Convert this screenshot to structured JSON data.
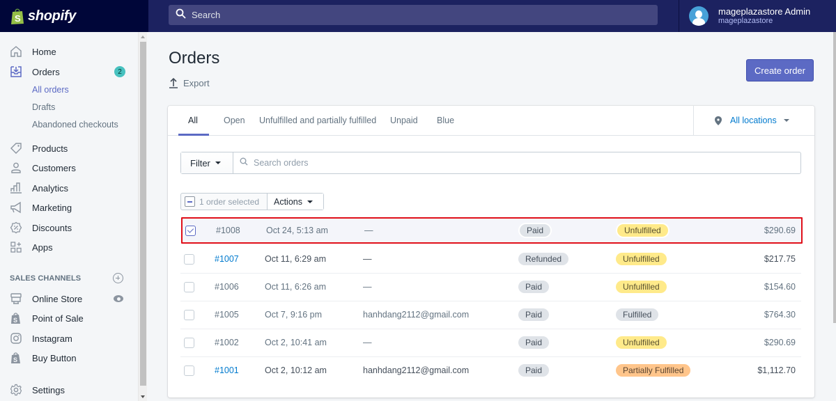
{
  "app": {
    "brand": "shopify",
    "search_placeholder": "Search",
    "user": {
      "name": "mageplazastore Admin",
      "store": "mageplazastore"
    }
  },
  "sidebar": {
    "items": [
      {
        "label": "Home",
        "icon": "home-icon"
      },
      {
        "label": "Orders",
        "icon": "orders-icon",
        "badge": "2"
      },
      {
        "label": "Products",
        "icon": "tag-icon"
      },
      {
        "label": "Customers",
        "icon": "person-icon"
      },
      {
        "label": "Analytics",
        "icon": "bar-chart-icon"
      },
      {
        "label": "Marketing",
        "icon": "megaphone-icon"
      },
      {
        "label": "Discounts",
        "icon": "discount-icon"
      },
      {
        "label": "Apps",
        "icon": "apps-icon"
      }
    ],
    "orders_sub": [
      "All orders",
      "Drafts",
      "Abandoned checkouts"
    ],
    "sales_channels_heading": "SALES CHANNELS",
    "channels": [
      {
        "label": "Online Store",
        "icon": "store-icon"
      },
      {
        "label": "Point of Sale",
        "icon": "shopping-bag-icon"
      },
      {
        "label": "Instagram",
        "icon": "instagram-icon"
      },
      {
        "label": "Buy Button",
        "icon": "shopping-bag-icon"
      }
    ],
    "settings": "Settings"
  },
  "page": {
    "title": "Orders",
    "export": "Export",
    "create_order": "Create order"
  },
  "tabs": [
    "All",
    "Open",
    "Unfulfilled and partially fulfilled",
    "Unpaid",
    "Blue"
  ],
  "active_tab": "All",
  "location": "All locations",
  "filter": {
    "label": "Filter",
    "search_placeholder": "Search orders"
  },
  "bulk": {
    "selected_text": "1 order selected",
    "actions": "Actions"
  },
  "orders": [
    {
      "number": "#1008",
      "date": "Oct 24, 5:13 am",
      "customer": "—",
      "payment": "Paid",
      "fulfillment": "Unfulfilled",
      "total": "$290.69",
      "selected": true
    },
    {
      "number": "#1007",
      "date": "Oct 11, 6:29 am",
      "customer": "—",
      "payment": "Refunded",
      "fulfillment": "Unfulfilled",
      "total": "$217.75",
      "selected": false
    },
    {
      "number": "#1006",
      "date": "Oct 11, 6:26 am",
      "customer": "—",
      "payment": "Paid",
      "fulfillment": "Unfulfilled",
      "total": "$154.60",
      "selected": false
    },
    {
      "number": "#1005",
      "date": "Oct 7, 9:16 pm",
      "customer": "hanhdang2112@gmail.com",
      "payment": "Paid",
      "fulfillment": "Fulfilled",
      "total": "$764.30",
      "selected": false
    },
    {
      "number": "#1002",
      "date": "Oct 2, 10:41 am",
      "customer": "—",
      "payment": "Paid",
      "fulfillment": "Unfulfilled",
      "total": "$290.69",
      "selected": false
    },
    {
      "number": "#1001",
      "date": "Oct 2, 10:12 am",
      "customer": "hanhdang2112@gmail.com",
      "payment": "Paid",
      "fulfillment": "Partially Fulfilled",
      "total": "$1,112.70",
      "selected": false
    }
  ],
  "colors": {
    "brand_dark": "#000639",
    "topbar": "#1c2260",
    "accent": "#5c6ac4",
    "link": "#007ace",
    "unfulfilled": "#ffea8a",
    "partially_fulfilled": "#ffc58b",
    "neutral_badge": "#dfe3e8",
    "highlight_border": "#e0101a",
    "orders_badge": "#47c1bf"
  }
}
